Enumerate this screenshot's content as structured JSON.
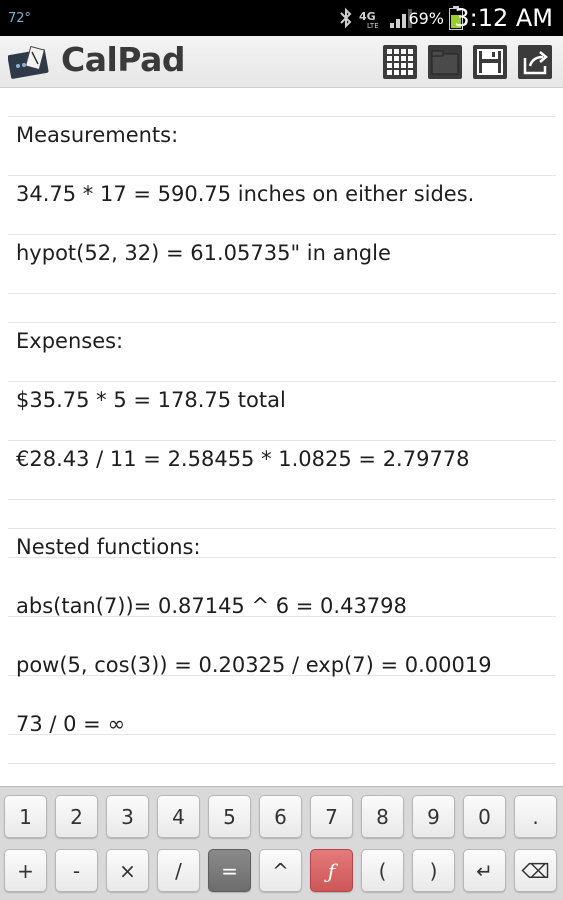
{
  "status_bar": {
    "temperature": "72°",
    "battery_percent": "69%",
    "time": "3:12 AM",
    "icons": [
      "bluetooth-icon",
      "4g-lte-icon",
      "signal-icon",
      "battery-icon"
    ]
  },
  "app": {
    "title": "CalPad",
    "actions": [
      {
        "name": "keypad-toggle",
        "icon": "grid-icon"
      },
      {
        "name": "open-file",
        "icon": "folder-icon"
      },
      {
        "name": "save-file",
        "icon": "floppy-disk-icon"
      },
      {
        "name": "share",
        "icon": "share-icon"
      }
    ]
  },
  "note": {
    "lines": [
      "Measurements:",
      "34.75 * 17 = 590.75 inches on either sides.",
      "hypot(52, 32) = 61.05735\" in angle",
      "",
      "Expenses:",
      "$35.75 * 5 = 178.75 total",
      "€28.43 / 11 = 2.58455 * 1.0825 = 2.79778",
      "",
      "Nested functions:",
      "abs(tan(7))= 0.87145 ^ 6 = 0.43798",
      "pow(5, cos(3)) = 0.20325 / exp(7) = 0.00019",
      "73 / 0 = ∞"
    ]
  },
  "keypad": {
    "row1": [
      "1",
      "2",
      "3",
      "4",
      "5",
      "6",
      "7",
      "8",
      "9",
      "0",
      "."
    ],
    "row2": [
      "+",
      "-",
      "×",
      "/",
      "=",
      "^",
      "ƒ",
      "(",
      ")",
      "↵",
      "⌫"
    ]
  },
  "colors": {
    "status_bar_bg": "#000000",
    "action_bar_bg": "#ececec",
    "equals_key": "#7a7a7a",
    "function_key": "#d96565",
    "rule_line": "#e4e4e4"
  }
}
